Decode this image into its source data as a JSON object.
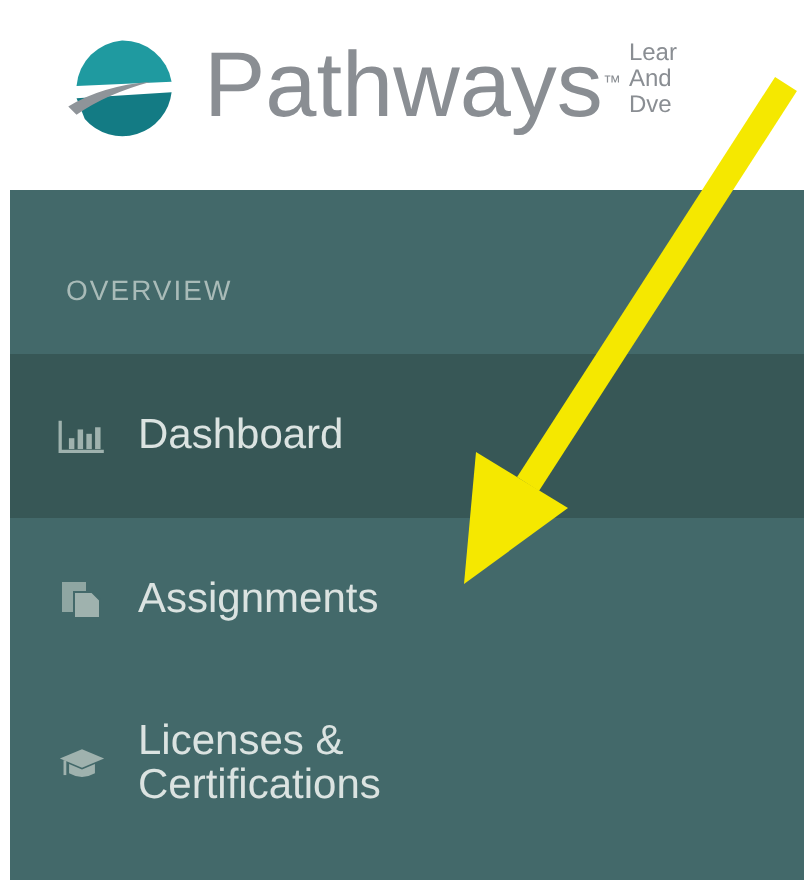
{
  "logo": {
    "name": "Pathways",
    "trademark": "™",
    "tagline": [
      "Lear",
      "And",
      "Dve"
    ]
  },
  "sidebar": {
    "section": "OVERVIEW",
    "items": [
      {
        "label": "Dashboard",
        "kind": "chart",
        "selected": true
      },
      {
        "label": "Assignments",
        "kind": "documents",
        "selected": false
      },
      {
        "label": "Licenses & Certifications",
        "kind": "cap",
        "selected": false
      }
    ]
  }
}
